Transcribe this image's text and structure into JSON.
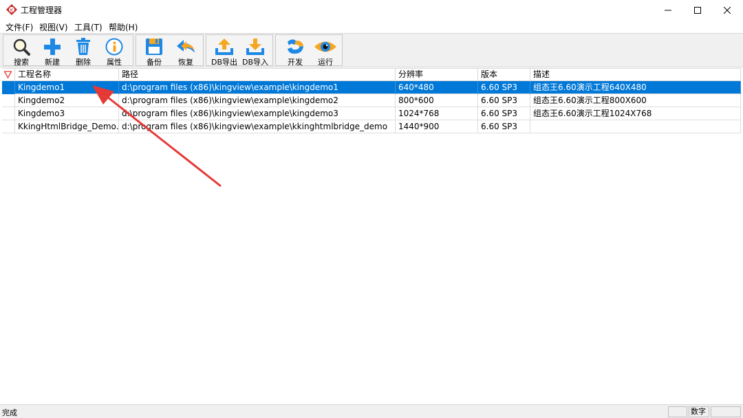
{
  "window": {
    "title": "工程管理器"
  },
  "menu": [
    "文件(F)",
    "视图(V)",
    "工具(T)",
    "帮助(H)"
  ],
  "toolbar": {
    "search": "搜索",
    "new": "新建",
    "delete": "删除",
    "properties": "属性",
    "backup": "备份",
    "restore": "恢复",
    "db_export": "DB导出",
    "db_import": "DB导入",
    "develop": "开发",
    "run": "运行"
  },
  "table": {
    "columns": [
      "工程名称",
      "路径",
      "分辨率",
      "版本",
      "描述"
    ],
    "rows": [
      {
        "name": "Kingdemo1",
        "path": "d:\\program files (x86)\\kingview\\example\\kingdemo1",
        "resolution": "640*480",
        "version": "6.60 SP3",
        "desc": "组态王6.60演示工程640X480",
        "selected": true
      },
      {
        "name": "Kingdemo2",
        "path": "d:\\program files (x86)\\kingview\\example\\kingdemo2",
        "resolution": "800*600",
        "version": "6.60 SP3",
        "desc": "组态王6.60演示工程800X600"
      },
      {
        "name": "Kingdemo3",
        "path": "d:\\program files (x86)\\kingview\\example\\kingdemo3",
        "resolution": "1024*768",
        "version": "6.60 SP3",
        "desc": "组态王6.60演示工程1024X768"
      },
      {
        "name": "KkingHtmlBridge_Demo...",
        "path": "d:\\program files (x86)\\kingview\\example\\kkinghtmlbridge_demo",
        "resolution": "1440*900",
        "version": "6.60 SP3",
        "desc": ""
      }
    ]
  },
  "status": {
    "text": "完成",
    "num": "数字"
  },
  "colors": {
    "selection": "#0078d7",
    "arrow": "#e53935",
    "accent_blue": "#1e88e5",
    "accent_orange": "#f5a623"
  }
}
